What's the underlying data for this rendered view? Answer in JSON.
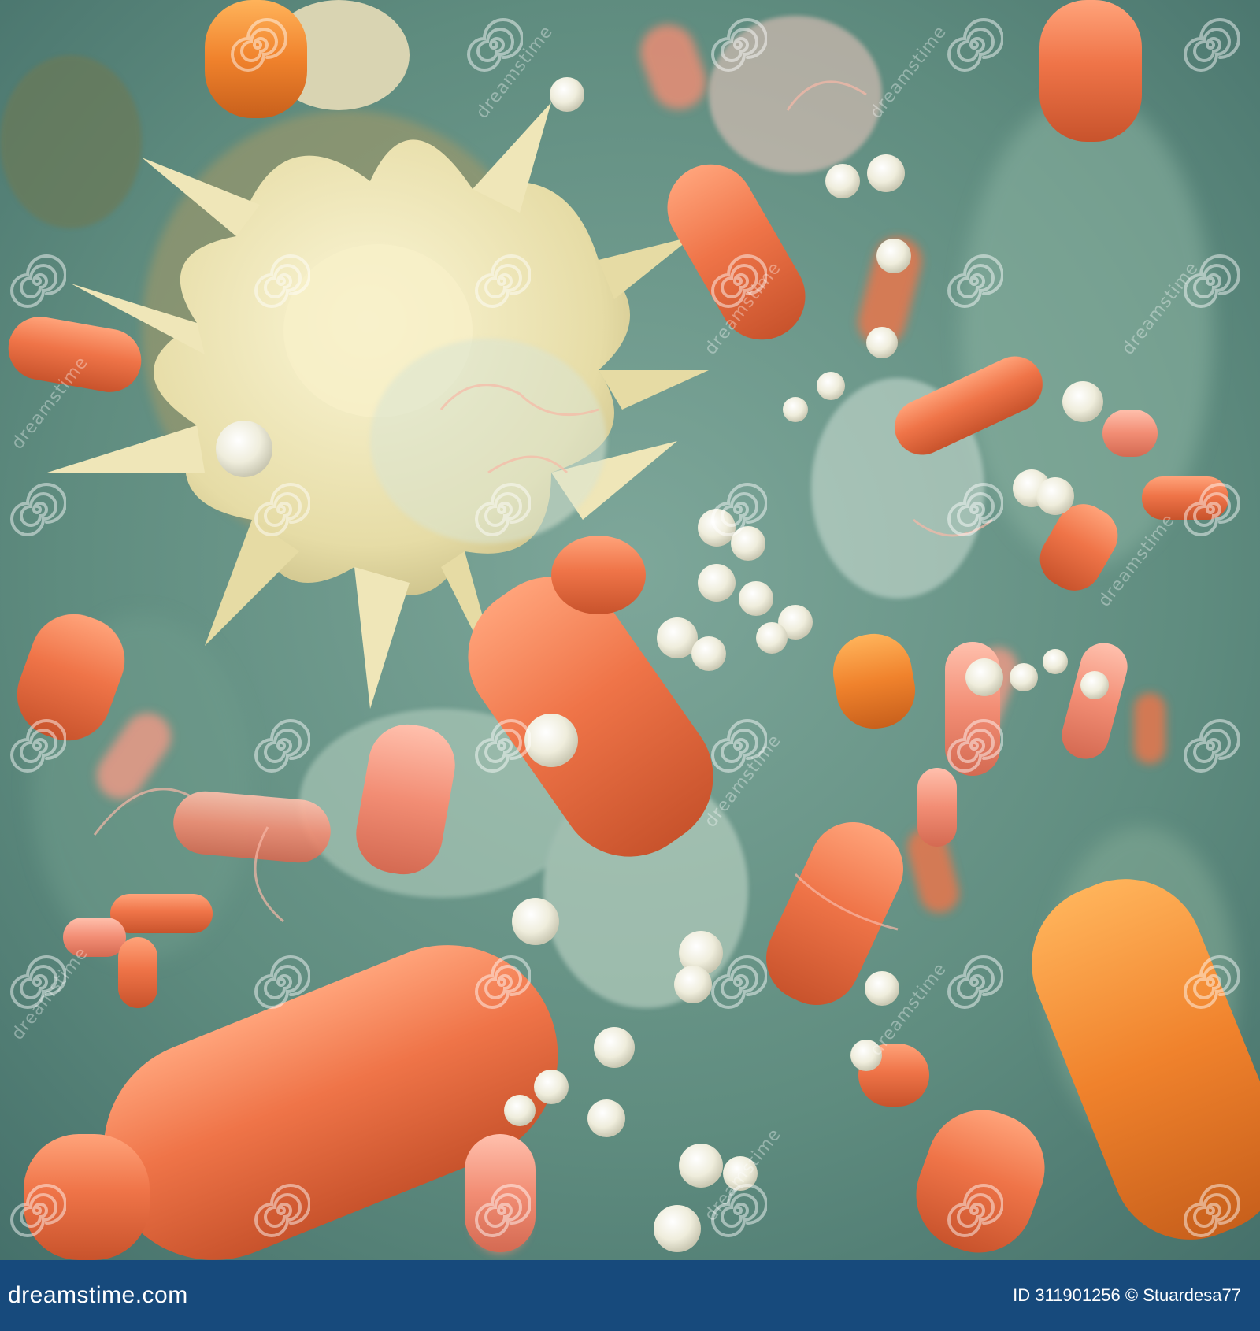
{
  "image": {
    "description_colors": {
      "background": "#5f8c7f",
      "bacteria_orange": "#ef7448",
      "bacteria_pink": "#f29a86",
      "spores_white": "#f1efe0",
      "cell_cream": "#ece4b4"
    }
  },
  "watermark": {
    "diagonal_text": "dreamstime",
    "spiral_icon": "dreamstime-spiral-icon"
  },
  "footer": {
    "brand": "dreamstime.com",
    "id_text": "ID 311901256",
    "credit_text": "© Stuardesa77",
    "background_color": "#174a7c"
  }
}
